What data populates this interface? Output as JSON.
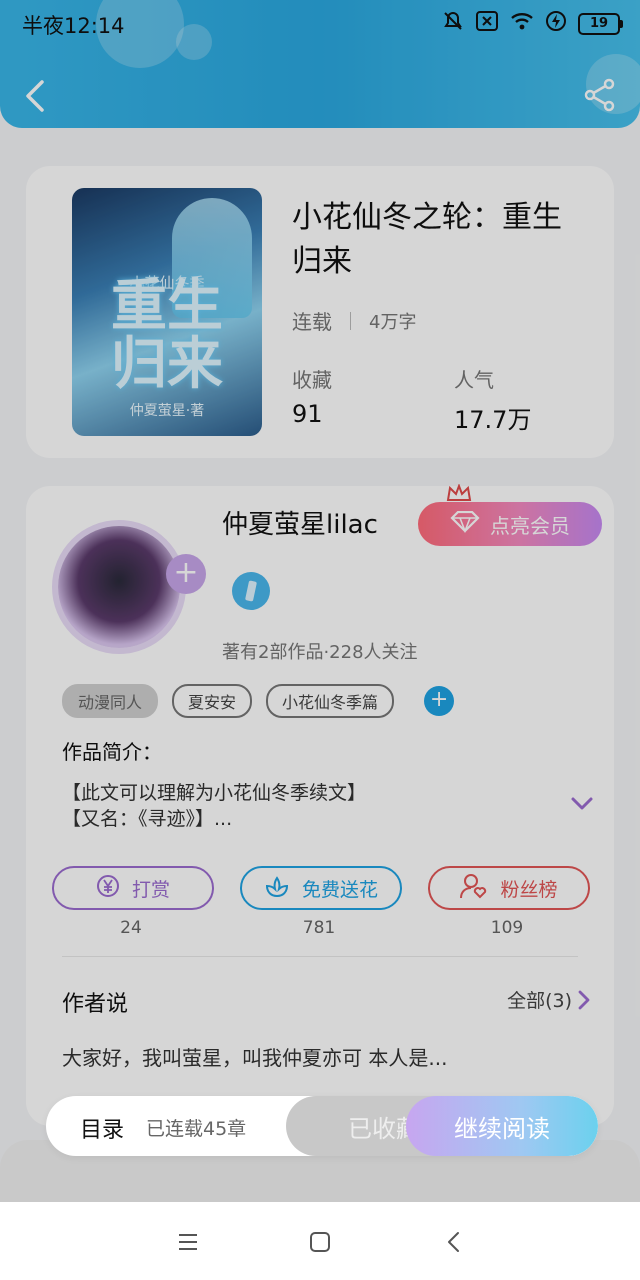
{
  "status_bar": {
    "time": "半夜12:14",
    "battery": "19"
  },
  "book": {
    "title": "小花仙冬之轮：重生归来",
    "status": "连载",
    "word_count": "4万字",
    "favorites_label": "收藏",
    "favorites_value": "91",
    "popularity_label": "人气",
    "popularity_value": "17.7万",
    "cover_top": "小花仙冬季",
    "cover_title": "重生归来",
    "cover_bottom": "仲夏萤星·著"
  },
  "author": {
    "name": "仲夏萤星lilac",
    "vip_label": "点亮会员",
    "stats": "著有2部作品·228人关注"
  },
  "tags": [
    "动漫同人",
    "夏安安",
    "小花仙冬季篇"
  ],
  "intro": {
    "label": "作品简介：",
    "line1": "【此文可以理解为小花仙冬季续文】",
    "line2": "【又名：《寻迹》】..."
  },
  "actions": [
    {
      "label": "打赏",
      "count": "24",
      "color": "#9b6cd0"
    },
    {
      "label": "免费送花",
      "count": "781",
      "color": "#1ea3e3"
    },
    {
      "label": "粉丝榜",
      "count": "109",
      "color": "#e25555"
    }
  ],
  "author_says": {
    "label": "作者说",
    "all": "全部(3)",
    "text": "大家好，我叫萤星，叫我仲夏亦可 本人是..."
  },
  "bottom_bar": {
    "catalog": "目录",
    "chapters": "已连载45章",
    "favorited": "已收藏",
    "continue": "继续阅读"
  }
}
